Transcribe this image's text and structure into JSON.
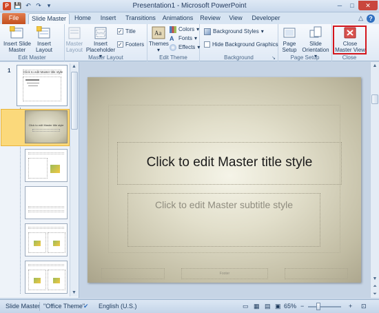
{
  "window": {
    "title": "Presentation1 - Microsoft PowerPoint",
    "app_badge": "P",
    "qat": [
      "💾",
      "↶",
      "↷",
      "▾"
    ],
    "controls": [
      "─",
      "□",
      "✕"
    ]
  },
  "tabs": [
    {
      "label": "File"
    },
    {
      "label": "Slide Master"
    },
    {
      "label": "Home"
    },
    {
      "label": "Insert"
    },
    {
      "label": "Transitions"
    },
    {
      "label": "Animations"
    },
    {
      "label": "Review"
    },
    {
      "label": "View"
    },
    {
      "label": "Developer"
    }
  ],
  "help": {
    "minimize": "△",
    "help": "?"
  },
  "ribbon": {
    "edit_master": {
      "label": "Edit Master",
      "insert_slide_master": "Insert Slide Master",
      "insert_layout": "Insert Layout"
    },
    "master_layout": {
      "label": "Master Layout",
      "master_layout": "Master Layout",
      "insert_placeholder": "Insert Placeholder",
      "title": "Title",
      "footers": "Footers",
      "title_checked": true,
      "footers_checked": true
    },
    "edit_theme": {
      "label": "Edit Theme",
      "themes": "Themes",
      "colors": "Colors",
      "fonts": "Fonts",
      "effects": "Effects"
    },
    "background": {
      "label": "Background",
      "background_styles": "Background Styles",
      "hide_background_graphics": "Hide Background Graphics",
      "launcher": "↘"
    },
    "page_setup": {
      "label": "Page Setup",
      "page_setup": "Page Setup",
      "slide_orientation": "Slide Orientation"
    },
    "close": {
      "label": "Close",
      "close_master_view": "Close Master View"
    }
  },
  "thumbnails": {
    "master_number": "1",
    "master_title": "Click to edit Master title style",
    "selected_title": "Click to edit Master title style"
  },
  "slide": {
    "title": "Click to edit Master title style",
    "subtitle": "Click to edit Master subtitle style",
    "footer": "Footer"
  },
  "status": {
    "view": "Slide Master",
    "theme": "\"Office Theme\"",
    "language": "English (U.S.)",
    "zoom": "65%",
    "zoom_minus": "−",
    "zoom_plus": "+"
  },
  "colors": {
    "accent_file": "#d24726",
    "highlight": "#d4141b",
    "selection": "#fbd97b"
  }
}
